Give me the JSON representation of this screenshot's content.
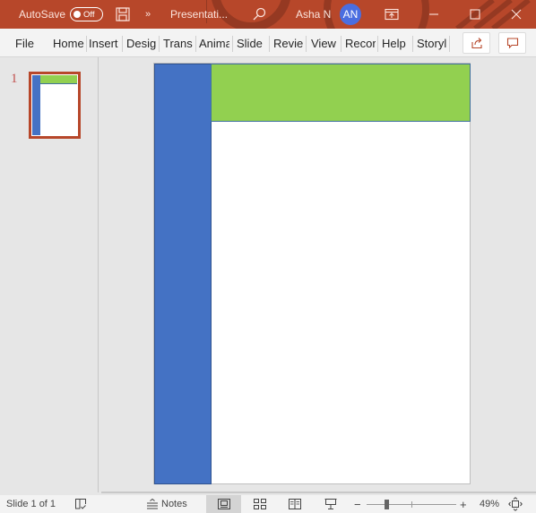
{
  "titlebar": {
    "autosave_label": "AutoSave",
    "autosave_state": "Off",
    "more_glyph": "»",
    "document_title": "Presentati...",
    "user_name": "Asha N",
    "user_initials": "AN"
  },
  "ribbon": {
    "tabs": [
      {
        "label": "File"
      },
      {
        "label": "Home"
      },
      {
        "label": "Insert"
      },
      {
        "label": "Desig"
      },
      {
        "label": "Trans"
      },
      {
        "label": "Anima"
      },
      {
        "label": "Slide"
      },
      {
        "label": "Revie"
      },
      {
        "label": "View"
      },
      {
        "label": "Recor"
      },
      {
        "label": "Help"
      },
      {
        "label": "Storyl"
      }
    ]
  },
  "thumbnails": [
    {
      "number": "1",
      "selected": true
    }
  ],
  "slide": {
    "shapes": [
      {
        "type": "rectangle",
        "fill": "#4472C4",
        "role": "left-bar"
      },
      {
        "type": "rectangle",
        "fill": "#92D050",
        "role": "top-banner"
      }
    ]
  },
  "statusbar": {
    "slide_position": "Slide 1 of 1",
    "notes_label": "Notes",
    "zoom_level": "49%",
    "zoom_minus": "−",
    "zoom_plus": "+",
    "zoom_fraction": 0.49
  },
  "colors": {
    "accent": "#B7472A",
    "blue_shape": "#4472C4",
    "green_shape": "#92D050"
  }
}
